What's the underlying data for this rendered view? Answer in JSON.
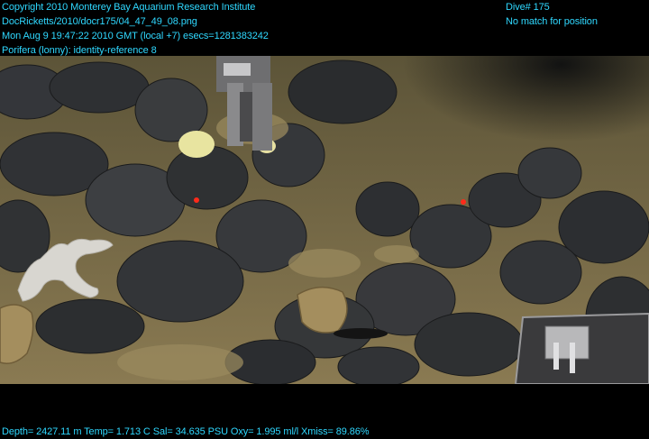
{
  "header": {
    "lines": [
      "Copyright 2010 Monterey Bay Aquarium Research Institute",
      "DocRicketts/2010/docr175/04_47_49_08.png",
      "Mon Aug  9 19:47:22 2010 GMT (local +7)  esecs=1281383242",
      "Porifera (lonny): identity-reference 8"
    ],
    "dive": "Dive# 175",
    "position_status": "No match for position"
  },
  "footer": {
    "telemetry": "Depth= 2427.11 m  Temp= 1.713 C  Sal= 34.635 PSU  Oxy= 1.995 ml/l  Xmiss= 89.86%"
  },
  "colors": {
    "overlay_text": "#2fd8ff",
    "laser_dot": "#ff2a1a",
    "sediment": "#8a7a52",
    "rock": "#2a2c2e"
  }
}
